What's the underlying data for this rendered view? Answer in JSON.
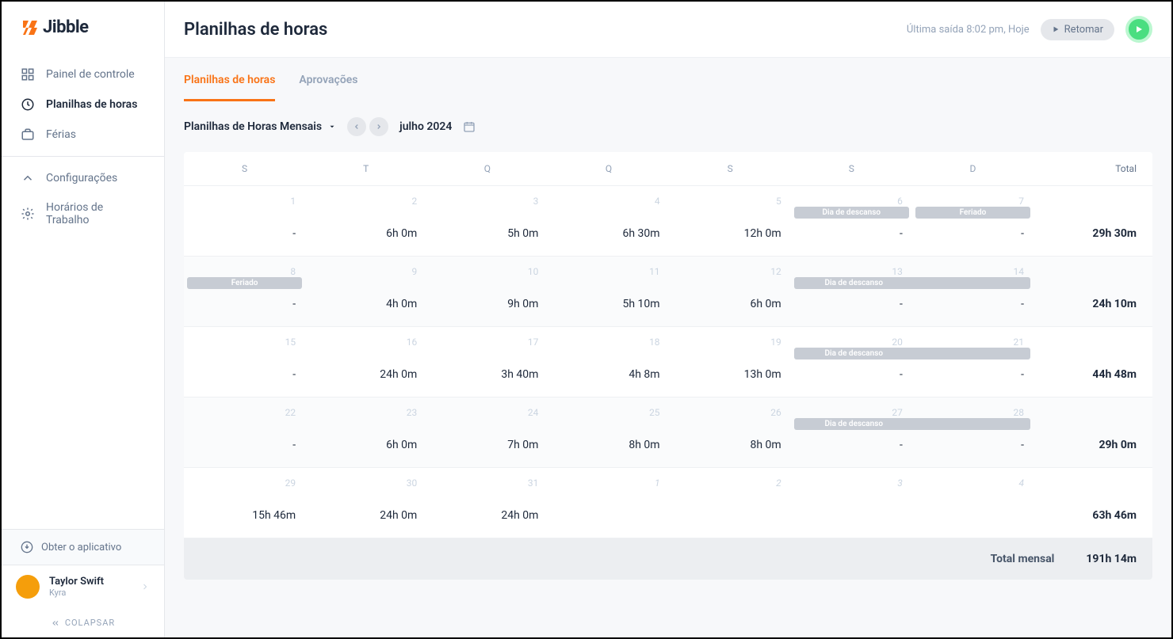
{
  "logo_text": "Jibble",
  "nav": {
    "dashboard": "Painel de controle",
    "timesheets": "Planilhas de horas",
    "vacation": "Férias",
    "settings": "Configurações",
    "schedules": "Horários de Trabalho"
  },
  "get_app": "Obter o aplicativo",
  "user": {
    "name": "Taylor Swift",
    "org": "Kyra"
  },
  "collapse": "COLAPSAR",
  "header": {
    "title": "Planilhas de horas",
    "status": "Última saída 8:02 pm, Hoje",
    "resume": "Retomar"
  },
  "tabs": {
    "timesheets": "Planilhas de horas",
    "approvals": "Aprovações"
  },
  "controls": {
    "view": "Planilhas de Horas Mensais",
    "month": "julho 2024"
  },
  "dayHeaders": [
    "S",
    "T",
    "Q",
    "Q",
    "S",
    "S",
    "D"
  ],
  "totalHeader": "Total",
  "badges": {
    "rest": "Dia de descanso",
    "holiday": "Feriado"
  },
  "weeks": [
    {
      "days": [
        {
          "n": "1",
          "v": "-"
        },
        {
          "n": "2",
          "v": "6h 0m"
        },
        {
          "n": "3",
          "v": "5h 0m"
        },
        {
          "n": "4",
          "v": "6h 30m"
        },
        {
          "n": "5",
          "v": "12h 0m"
        },
        {
          "n": "6",
          "v": "-",
          "badge": "rest"
        },
        {
          "n": "7",
          "v": "-",
          "badge": "holiday"
        }
      ],
      "total": "29h 30m"
    },
    {
      "days": [
        {
          "n": "8",
          "v": "-",
          "badge": "holiday"
        },
        {
          "n": "9",
          "v": "4h 0m"
        },
        {
          "n": "10",
          "v": "9h 0m"
        },
        {
          "n": "11",
          "v": "5h 10m"
        },
        {
          "n": "12",
          "v": "6h 0m"
        },
        {
          "n": "13",
          "v": "-",
          "badge": "rest",
          "span": "left"
        },
        {
          "n": "14",
          "v": "-",
          "badge": "rest",
          "span": "right"
        }
      ],
      "total": "24h 10m"
    },
    {
      "days": [
        {
          "n": "15",
          "v": "-"
        },
        {
          "n": "16",
          "v": "24h 0m"
        },
        {
          "n": "17",
          "v": "3h 40m"
        },
        {
          "n": "18",
          "v": "4h 8m"
        },
        {
          "n": "19",
          "v": "13h 0m"
        },
        {
          "n": "20",
          "v": "-",
          "badge": "rest",
          "span": "left"
        },
        {
          "n": "21",
          "v": "-",
          "badge": "rest",
          "span": "right"
        }
      ],
      "total": "44h 48m"
    },
    {
      "days": [
        {
          "n": "22",
          "v": "-"
        },
        {
          "n": "23",
          "v": "6h 0m"
        },
        {
          "n": "24",
          "v": "7h 0m"
        },
        {
          "n": "25",
          "v": "8h 0m"
        },
        {
          "n": "26",
          "v": "8h 0m"
        },
        {
          "n": "27",
          "v": "-",
          "badge": "rest",
          "span": "left"
        },
        {
          "n": "28",
          "v": "-",
          "badge": "rest",
          "span": "right"
        }
      ],
      "total": "29h 0m"
    },
    {
      "days": [
        {
          "n": "29",
          "v": "15h 46m"
        },
        {
          "n": "30",
          "v": "24h 0m"
        },
        {
          "n": "31",
          "v": "24h 0m"
        },
        {
          "n": "1",
          "v": "",
          "faded": true
        },
        {
          "n": "2",
          "v": "",
          "faded": true
        },
        {
          "n": "3",
          "v": "",
          "faded": true
        },
        {
          "n": "4",
          "v": "",
          "faded": true
        }
      ],
      "total": "63h 46m"
    }
  ],
  "footer": {
    "label": "Total mensal",
    "total": "191h 14m"
  }
}
